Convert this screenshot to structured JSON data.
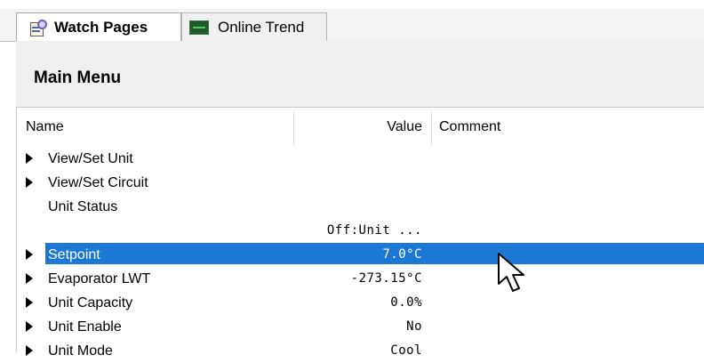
{
  "tabs": [
    {
      "label": "Watch Pages",
      "icon": "watch-pages-icon",
      "active": true
    },
    {
      "label": "Online Trend",
      "icon": "trend-icon",
      "active": false
    }
  ],
  "page_title": "Main Menu",
  "columns": {
    "name": "Name",
    "value": "Value",
    "comment": "Comment"
  },
  "rows": [
    {
      "label": "View/Set Unit",
      "value": "",
      "expandable": true
    },
    {
      "label": "View/Set Circuit",
      "value": "",
      "expandable": true
    },
    {
      "label": "Unit Status",
      "value": "",
      "expandable": false
    },
    {
      "label": "",
      "value": "Off:Unit ...",
      "expandable": false
    },
    {
      "label": "Setpoint",
      "value": "7.0°C",
      "expandable": true,
      "selected": true
    },
    {
      "label": "Evaporator LWT",
      "value": "-273.15°C",
      "expandable": true
    },
    {
      "label": "Unit Capacity",
      "value": "0.0%",
      "expandable": true
    },
    {
      "label": "Unit Enable",
      "value": "No",
      "expandable": true
    },
    {
      "label": "Unit Mode",
      "value": "Cool",
      "expandable": true
    }
  ],
  "colors": {
    "selection": "#1c78d4"
  }
}
